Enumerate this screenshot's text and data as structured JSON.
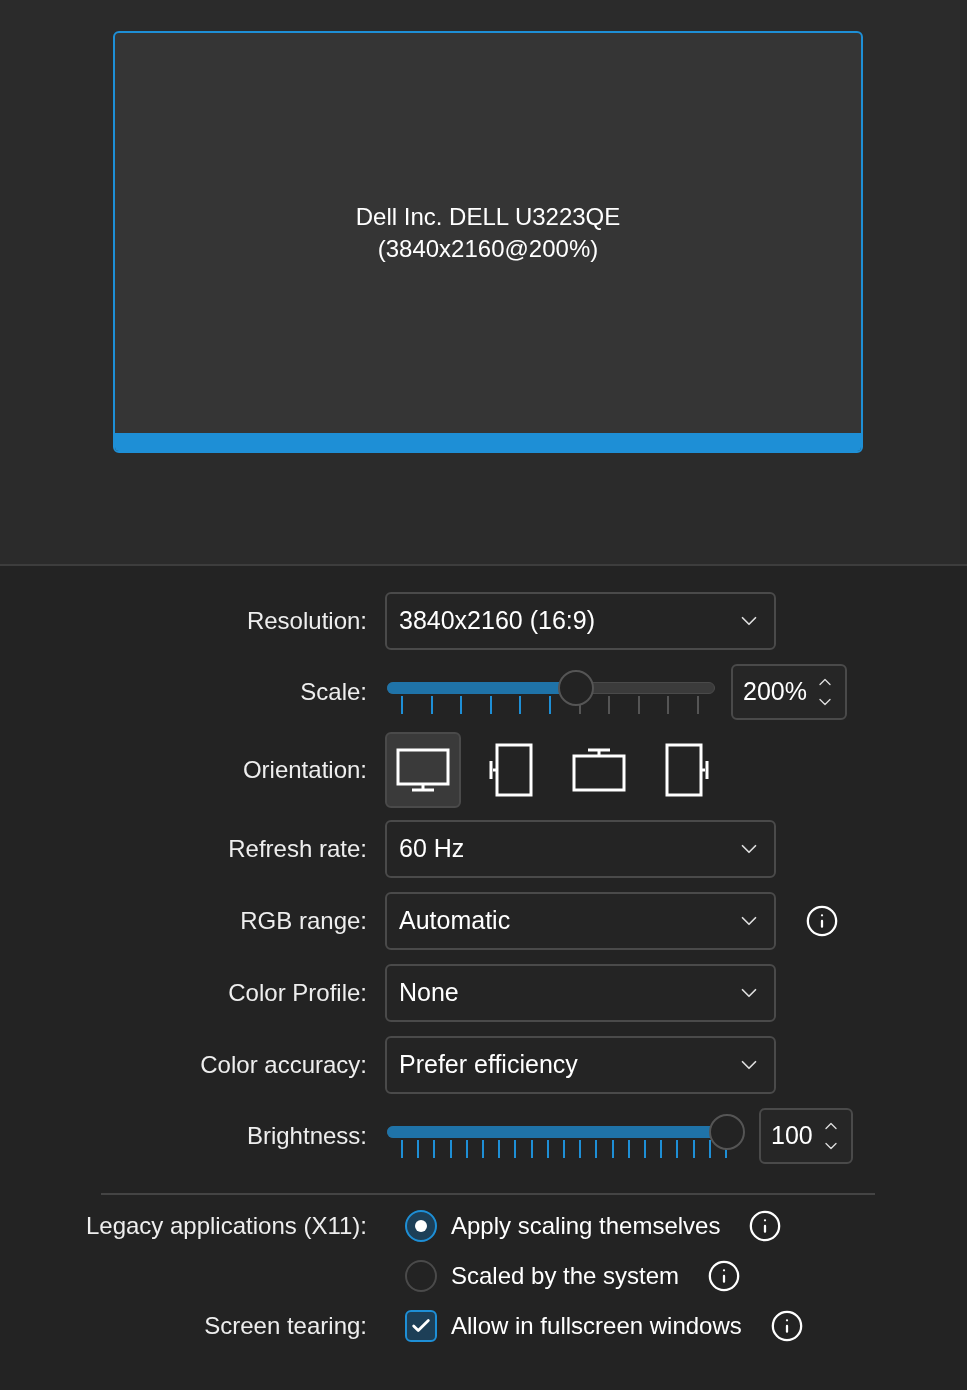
{
  "monitor": {
    "name": "Dell Inc. DELL U3223QE",
    "mode": "(3840x2160@200%)",
    "selected": true
  },
  "settings": [
    {
      "kind": "dropdown",
      "label": "Resolution:",
      "value": "3840x2160 (16:9)",
      "info": false
    },
    {
      "kind": "coarse-slider",
      "label": "Scale:",
      "level": 0.585,
      "reading": "200%"
    },
    {
      "kind": "orientation",
      "label": "Orientation:",
      "options": [
        {
          "kind": "landscape",
          "selected": true
        },
        {
          "kind": "portrait-left",
          "selected": false
        },
        {
          "kind": "landscape-flipped",
          "selected": false
        },
        {
          "kind": "portrait-right",
          "selected": false
        }
      ]
    },
    {
      "kind": "dropdown",
      "label": "Refresh rate:",
      "value": "60 Hz",
      "info": false
    },
    {
      "kind": "dropdown",
      "label": "RGB range:",
      "value": "Automatic",
      "info": true
    },
    {
      "kind": "dropdown",
      "label": "Color Profile:",
      "value": "None",
      "info": false
    },
    {
      "kind": "dropdown",
      "label": "Color accuracy:",
      "value": "Prefer efficiency",
      "info": false
    },
    {
      "kind": "fine-slider",
      "label": "Brightness:",
      "level": 1,
      "reading": "100"
    }
  ],
  "legacy": {
    "label": "Legacy applications (X11):",
    "options": [
      {
        "label": "Apply scaling themselves",
        "selected": true,
        "info": true
      },
      {
        "label": "Scaled by the system",
        "selected": false,
        "info": true
      }
    ]
  },
  "tearing": {
    "label": "Screen tearing:",
    "option": {
      "label": "Allow in fullscreen windows",
      "checked": true,
      "info": true
    }
  }
}
